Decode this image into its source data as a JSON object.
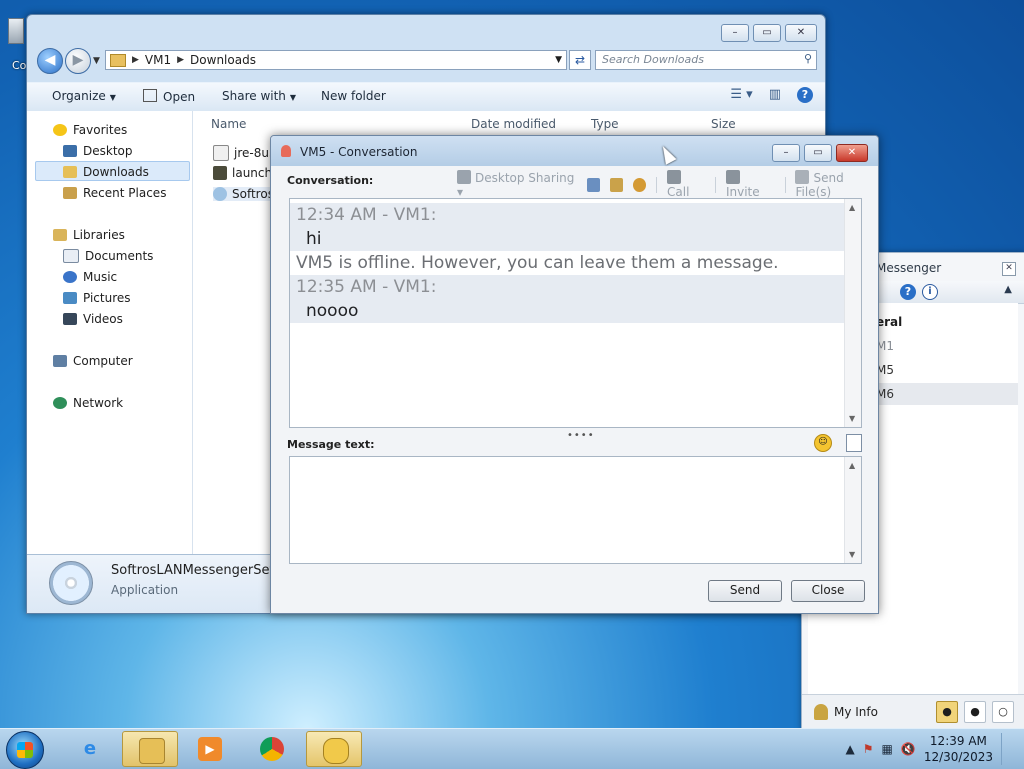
{
  "desktop": {
    "icon_label": "Co"
  },
  "explorer": {
    "path": [
      "VM1",
      "Downloads"
    ],
    "search_placeholder": "Search Downloads",
    "toolbar": {
      "organize": "Organize",
      "open": "Open",
      "share_with": "Share with",
      "new_folder": "New folder"
    },
    "nav": {
      "favorites": "Favorites",
      "desktop": "Desktop",
      "downloads": "Downloads",
      "recent": "Recent Places",
      "libraries": "Libraries",
      "documents": "Documents",
      "music": "Music",
      "pictures": "Pictures",
      "videos": "Videos",
      "computer": "Computer",
      "network": "Network"
    },
    "columns": {
      "name": "Name",
      "date": "Date modified",
      "type": "Type",
      "size": "Size"
    },
    "files": [
      "jre-8u39",
      "launche",
      "Softros"
    ],
    "details": {
      "name": "SoftrosLANMessengerSetup",
      "type": "Application"
    }
  },
  "messenger": {
    "title": "Messenger",
    "group": "eral",
    "users": [
      "M1",
      "M5",
      "M6"
    ],
    "my_info": "My Info"
  },
  "conversation": {
    "title": "VM5 - Conversation",
    "conversation_label": "Conversation:",
    "toolbar": {
      "desktop_sharing": "Desktop Sharing",
      "call": "Call",
      "invite": "Invite",
      "send_files": "Send File(s)"
    },
    "messages": {
      "h1": "12:34 AM - VM1:",
      "m1": "hi",
      "system": "VM5 is offline. However, you can leave them a message.",
      "h2": "12:35 AM - VM1:",
      "m2": "noooo"
    },
    "message_text_label": "Message text:",
    "send": "Send",
    "close": "Close"
  },
  "taskbar": {
    "time": "12:39 AM",
    "date": "12/30/2023"
  }
}
